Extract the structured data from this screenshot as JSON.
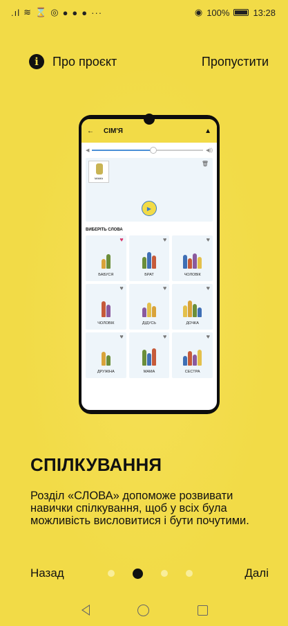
{
  "status_bar": {
    "left_icons": "signal wifi hourglass camera fb fb fb ···",
    "battery": "100%",
    "time": "13:28"
  },
  "header": {
    "about_label": "Про проєкт",
    "skip_label": "Пропустити"
  },
  "phone": {
    "screen_title": "СІМ'Я",
    "sentence_card_label": "МАМА",
    "volume_level": 0.55,
    "choose_title": "ВИБЕРІТЬ СЛОВА",
    "words": [
      {
        "label": "БАБУСЯ",
        "favorite": true
      },
      {
        "label": "БРАТ",
        "favorite": false
      },
      {
        "label": "ЧОЛОВІК",
        "favorite": false
      },
      {
        "label": "ЧОЛОВІК",
        "favorite": false
      },
      {
        "label": "ДІДУСЬ",
        "favorite": false
      },
      {
        "label": "ДОЧКА",
        "favorite": false
      },
      {
        "label": "ДРУЖІНА",
        "favorite": false
      },
      {
        "label": "МАМА",
        "favorite": false
      },
      {
        "label": "СЕСТРА",
        "favorite": false
      }
    ]
  },
  "onboarding": {
    "title": "СПІЛКУВАННЯ",
    "description": "Розділ «СЛОВА» допоможе розвивати навички спілкування, щоб у всіх була можливість висловитися і бути почутими."
  },
  "navigation": {
    "back_label": "Назад",
    "next_label": "Далі",
    "page_count": 4,
    "active_page": 2
  },
  "colors": {
    "background": "#F2DB47",
    "accent_blue": "#3A7BC8",
    "favorite": "#D7376B"
  }
}
